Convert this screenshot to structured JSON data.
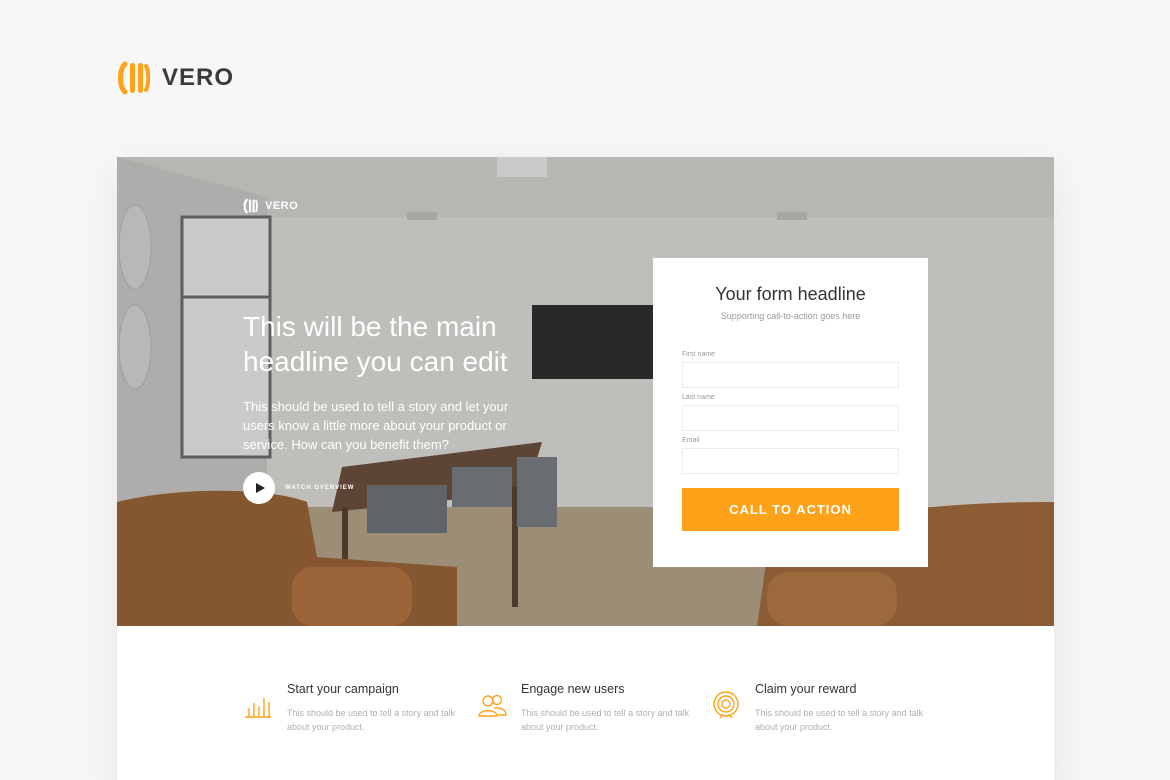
{
  "brand": {
    "name": "VERO",
    "accent": "#ffa21a"
  },
  "hero": {
    "logo_name": "VERO",
    "headline": "This will be the main headline you can edit",
    "subtext": "This should be used to tell a story and let your users know a little more about your product or service. How can you benefit them?",
    "watch_label": "WATCH OVERVIEW",
    "play_icon": "play-icon"
  },
  "form": {
    "title": "Your form headline",
    "subtitle": "Supporting call-to-action goes here",
    "fields": [
      {
        "label": "First name",
        "value": ""
      },
      {
        "label": "Last name",
        "value": ""
      },
      {
        "label": "Email",
        "value": ""
      }
    ],
    "cta_label": "CALL TO ACTION"
  },
  "features": [
    {
      "icon": "bar-chart-icon",
      "title": "Start your campaign",
      "desc": "This should be used to tell a story and talk about your product."
    },
    {
      "icon": "users-icon",
      "title": "Engage new users",
      "desc": "This should be used to tell a story and talk about your product."
    },
    {
      "icon": "target-icon",
      "title": "Claim your reward",
      "desc": "This should be used to tell a story and talk about your product."
    }
  ]
}
